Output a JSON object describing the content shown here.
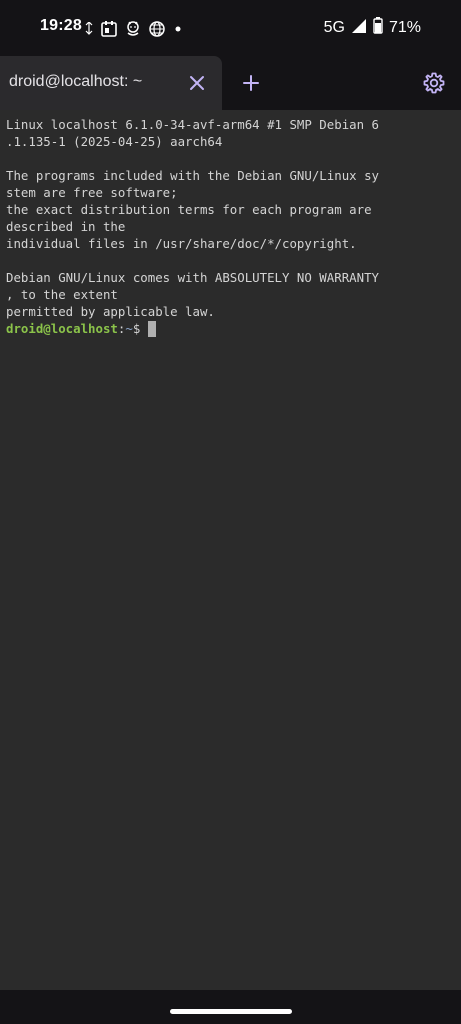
{
  "status_bar": {
    "time": "19:28",
    "network": "5G",
    "battery": "71%",
    "icons": [
      "data-arrows-icon",
      "calendar-icon",
      "android-icon",
      "globe-icon",
      "notification-dot-icon",
      "signal-icon",
      "battery-icon"
    ]
  },
  "tabs": [
    {
      "label": "droid@localhost: ~",
      "active": true
    }
  ],
  "toolbar": {
    "close_icon": "close-icon",
    "add_icon": "plus-icon",
    "settings_icon": "gear-icon",
    "accent_color": "#c3b4f5"
  },
  "terminal": {
    "lines": [
      "Linux localhost 6.1.0-34-avf-arm64 #1 SMP Debian 6",
      ".1.135-1 (2025-04-25) aarch64",
      "",
      "The programs included with the Debian GNU/Linux sy",
      "stem are free software;",
      "the exact distribution terms for each program are",
      "described in the",
      "individual files in /usr/share/doc/*/copyright.",
      "",
      "Debian GNU/Linux comes with ABSOLUTELY NO WARRANTY",
      ", to the extent",
      "permitted by applicable law."
    ],
    "prompt": {
      "user_host": "droid@localhost",
      "separator": ":",
      "path": "~",
      "symbol": "$ "
    },
    "colors": {
      "background": "#2b2b2b",
      "text": "#d4d4d4",
      "prompt_user": "#8bc34a"
    }
  }
}
